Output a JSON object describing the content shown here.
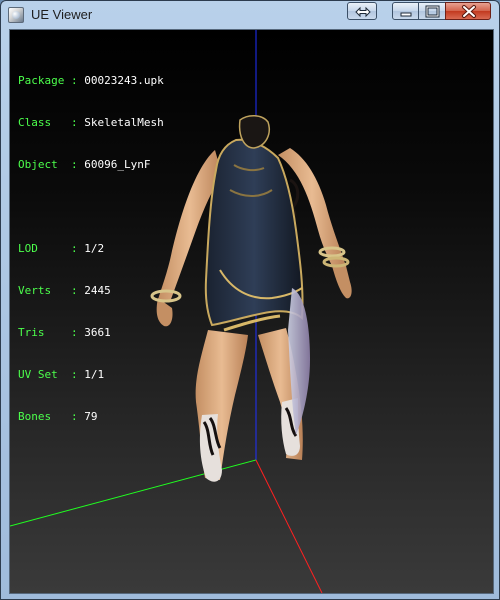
{
  "window": {
    "title": "UE Viewer"
  },
  "stats": {
    "group1": [
      {
        "key": "Package",
        "sep": ":",
        "value": "00023243.upk"
      },
      {
        "key": "Class  ",
        "sep": ":",
        "value": "SkeletalMesh"
      },
      {
        "key": "Object ",
        "sep": ":",
        "value": "60096_LynF"
      }
    ],
    "group2": [
      {
        "key": "LOD    ",
        "sep": ":",
        "value": "1/2"
      },
      {
        "key": "Verts  ",
        "sep": ":",
        "value": "2445"
      },
      {
        "key": "Tris   ",
        "sep": ":",
        "value": "3661"
      },
      {
        "key": "UV Set ",
        "sep": ":",
        "value": "1/1"
      },
      {
        "key": "Bones  ",
        "sep": ":",
        "value": "79"
      }
    ]
  },
  "colors": {
    "stat_key": "#4cff4c",
    "stat_value": "#ffffff",
    "axis_x": "#ff2020",
    "axis_y": "#20ff20",
    "axis_z": "#2030ff"
  },
  "icons": [
    "ue-viewer-app-icon",
    "swap-icon",
    "minimize-icon",
    "maximize-icon",
    "close-icon"
  ]
}
